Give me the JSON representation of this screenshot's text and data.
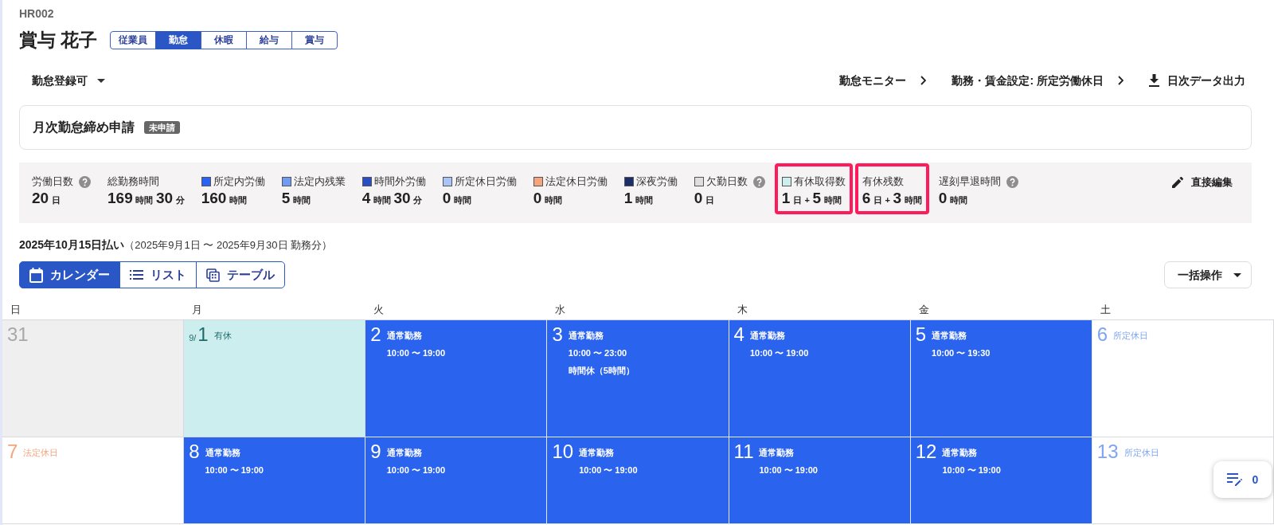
{
  "employee": {
    "code": "HR002",
    "name": "賞与 花子"
  },
  "tabs": [
    {
      "label": "従業員",
      "selected": false
    },
    {
      "label": "勤怠",
      "selected": true
    },
    {
      "label": "休暇",
      "selected": false
    },
    {
      "label": "給与",
      "selected": false
    },
    {
      "label": "賞与",
      "selected": false
    }
  ],
  "status_dropdown": {
    "label": "勤怠登録可"
  },
  "links": [
    {
      "label": "勤怠モニター",
      "kind": "chevron"
    },
    {
      "label": "勤務・賃金設定: 所定労働休日",
      "kind": "chevron"
    },
    {
      "label": "日次データ出力",
      "kind": "download"
    }
  ],
  "closing_request": {
    "title": "月次勤怠締め申請",
    "status": "未申請"
  },
  "summary": {
    "items": [
      {
        "label": "労働日数",
        "help": true,
        "highlighted": false,
        "value": [
          {
            "text": "20",
            "kind": "number"
          },
          {
            "text": "日",
            "kind": "unit"
          }
        ]
      },
      {
        "label": "総勤務時間",
        "help": false,
        "highlighted": false,
        "value": [
          {
            "text": "169",
            "kind": "number"
          },
          {
            "text": "時間",
            "kind": "unit"
          },
          {
            "text": "30",
            "kind": "number"
          },
          {
            "text": "分",
            "kind": "unit"
          }
        ]
      },
      {
        "label": "所定内労働",
        "color": "#2962f5",
        "help": false,
        "highlighted": false,
        "value": [
          {
            "text": "160",
            "kind": "number"
          },
          {
            "text": "時間",
            "kind": "unit"
          }
        ]
      },
      {
        "label": "法定内残業",
        "color": "#6e9cf2",
        "help": false,
        "highlighted": false,
        "value": [
          {
            "text": "5",
            "kind": "number"
          },
          {
            "text": "時間",
            "kind": "unit"
          }
        ]
      },
      {
        "label": "時間外労働",
        "color": "#2a4fc2",
        "help": false,
        "highlighted": false,
        "value": [
          {
            "text": "4",
            "kind": "number"
          },
          {
            "text": "時間",
            "kind": "unit"
          },
          {
            "text": "30",
            "kind": "number"
          },
          {
            "text": "分",
            "kind": "unit"
          }
        ]
      },
      {
        "label": "所定休日労働",
        "color": "#a9c5f7",
        "help": false,
        "highlighted": false,
        "value": [
          {
            "text": "0",
            "kind": "number"
          },
          {
            "text": "時間",
            "kind": "unit"
          }
        ]
      },
      {
        "label": "法定休日労働",
        "color": "#f6a47c",
        "help": false,
        "highlighted": false,
        "value": [
          {
            "text": "0",
            "kind": "number"
          },
          {
            "text": "時間",
            "kind": "unit"
          }
        ]
      },
      {
        "label": "深夜労働",
        "color": "#1b2e6b",
        "help": false,
        "highlighted": false,
        "value": [
          {
            "text": "1",
            "kind": "number"
          },
          {
            "text": "時間",
            "kind": "unit"
          }
        ]
      },
      {
        "label": "欠勤日数",
        "color": "#dedede",
        "help": true,
        "highlighted": false,
        "value": [
          {
            "text": "0",
            "kind": "number"
          },
          {
            "text": "日",
            "kind": "unit"
          }
        ]
      },
      {
        "label": "有休取得数",
        "color": "#cdeeee",
        "help": false,
        "highlighted": true,
        "value": [
          {
            "text": "1",
            "kind": "number"
          },
          {
            "text": "日",
            "kind": "unit"
          },
          {
            "text": "+",
            "kind": "plus"
          },
          {
            "text": "5",
            "kind": "number"
          },
          {
            "text": "時間",
            "kind": "unit"
          }
        ]
      },
      {
        "label": "有休残数",
        "help": false,
        "highlighted": true,
        "value": [
          {
            "text": "6",
            "kind": "number"
          },
          {
            "text": "日",
            "kind": "unit"
          },
          {
            "text": "+",
            "kind": "plus"
          },
          {
            "text": "3",
            "kind": "number"
          },
          {
            "text": "時間",
            "kind": "unit"
          }
        ]
      },
      {
        "label": "遅刻早退時間",
        "help": true,
        "highlighted": false,
        "value": [
          {
            "text": "0",
            "kind": "number"
          },
          {
            "text": "時間",
            "kind": "unit"
          }
        ]
      }
    ],
    "edit_button": "直接編集"
  },
  "period": {
    "payment": "2025年10月15日払い",
    "range": "（2025年9月1日 〜 2025年9月30日 勤務分）"
  },
  "views": [
    {
      "label": "カレンダー",
      "kind": "calendar",
      "selected": true
    },
    {
      "label": "リスト",
      "kind": "list",
      "selected": false
    },
    {
      "label": "テーブル",
      "kind": "table",
      "selected": false
    }
  ],
  "bulk_action": {
    "label": "一括操作"
  },
  "calendar": {
    "weekdays": [
      "日",
      "月",
      "火",
      "水",
      "木",
      "金",
      "土"
    ],
    "weeks": [
      [
        {
          "day": "31",
          "kind": "other_month"
        },
        {
          "prefix": "9/",
          "day": "1",
          "kind": "paid_leave",
          "label": "有休"
        },
        {
          "day": "2",
          "kind": "work",
          "label": "通常勤務",
          "lines": [
            "10:00 〜 19:00"
          ]
        },
        {
          "day": "3",
          "kind": "work",
          "label": "通常勤務",
          "lines": [
            "10:00 〜 23:00",
            "時間休（5時間）"
          ]
        },
        {
          "day": "4",
          "kind": "work",
          "label": "通常勤務",
          "lines": [
            "10:00 〜 19:00"
          ]
        },
        {
          "day": "5",
          "kind": "work",
          "label": "通常勤務",
          "lines": [
            "10:00 〜 19:30"
          ]
        },
        {
          "day": "6",
          "kind": "scheduled_holiday",
          "label": "所定休日"
        }
      ],
      [
        {
          "day": "7",
          "kind": "legal_holiday",
          "label": "法定休日"
        },
        {
          "day": "8",
          "kind": "work",
          "label": "通常勤務",
          "lines": [
            "10:00 〜 19:00"
          ]
        },
        {
          "day": "9",
          "kind": "work",
          "label": "通常勤務",
          "lines": [
            "10:00 〜 19:00"
          ]
        },
        {
          "day": "10",
          "kind": "work",
          "label": "通常勤務",
          "lines": [
            "10:00 〜 19:00"
          ]
        },
        {
          "day": "11",
          "kind": "work",
          "label": "通常勤務",
          "lines": [
            "10:00 〜 19:00"
          ]
        },
        {
          "day": "12",
          "kind": "work",
          "label": "通常勤務",
          "lines": [
            "10:00 〜 19:00"
          ]
        },
        {
          "day": "13",
          "kind": "scheduled_holiday",
          "label": "所定休日"
        }
      ]
    ]
  },
  "floating_button": {
    "count": "0"
  }
}
